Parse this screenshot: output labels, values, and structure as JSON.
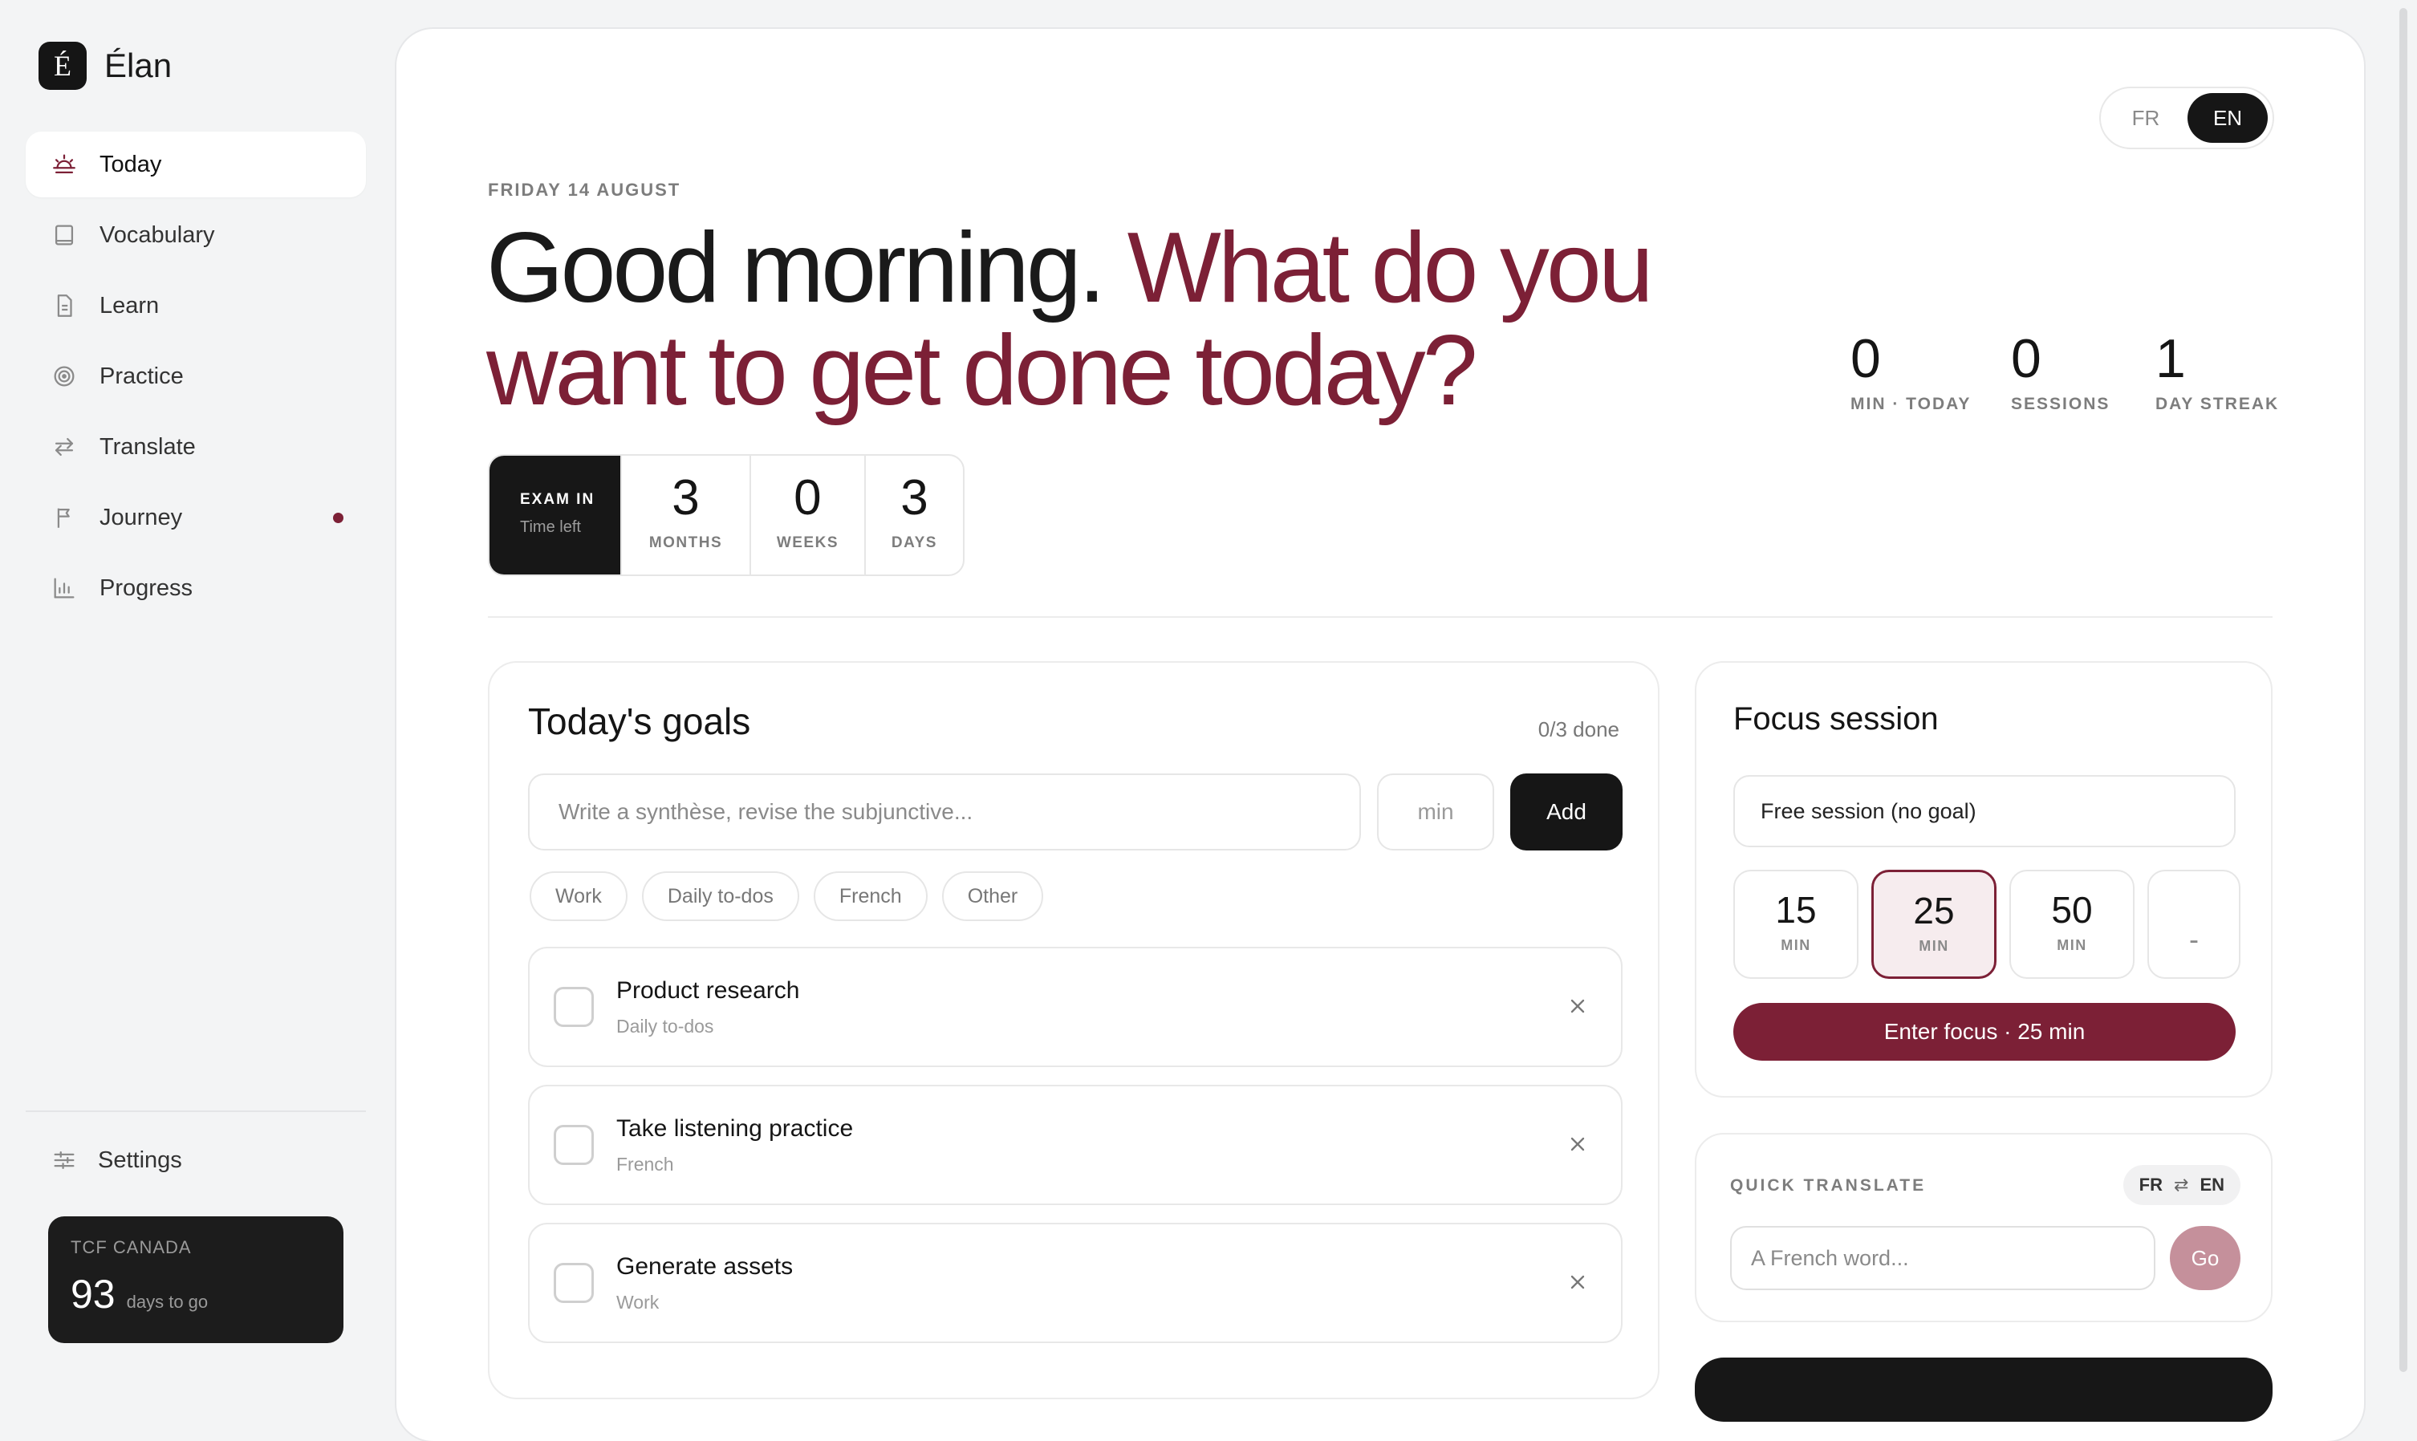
{
  "brand": {
    "mark": "É",
    "name": "Élan"
  },
  "nav": {
    "items": [
      {
        "label": "Today",
        "icon": "sunrise-icon",
        "active": true
      },
      {
        "label": "Vocabulary",
        "icon": "book-icon"
      },
      {
        "label": "Learn",
        "icon": "document-icon"
      },
      {
        "label": "Practice",
        "icon": "target-icon"
      },
      {
        "label": "Translate",
        "icon": "swap-arrows-icon"
      },
      {
        "label": "Journey",
        "icon": "flag-icon",
        "badge": true
      },
      {
        "label": "Progress",
        "icon": "bar-chart-icon"
      }
    ],
    "settings_label": "Settings"
  },
  "exam_card": {
    "label": "TCF CANADA",
    "days": "93",
    "suffix": "days to go"
  },
  "lang_toggle": {
    "options": [
      "FR",
      "EN"
    ],
    "selected": "EN"
  },
  "header": {
    "date": "FRIDAY 14 AUGUST",
    "greeting": "Good morning.",
    "question": "What do you want to get done today?"
  },
  "stats": [
    {
      "value": "0",
      "label": "MIN · TODAY"
    },
    {
      "value": "0",
      "label": "SESSIONS"
    },
    {
      "value": "1",
      "label": "DAY STREAK"
    }
  ],
  "countdown": {
    "title": "EXAM IN",
    "subtitle": "Time left",
    "units": [
      {
        "value": "3",
        "label": "MONTHS"
      },
      {
        "value": "0",
        "label": "WEEKS"
      },
      {
        "value": "3",
        "label": "DAYS"
      }
    ]
  },
  "goals": {
    "title": "Today's goals",
    "count": "0/3 done",
    "input_placeholder": "Write a synthèse, revise the subjunctive...",
    "minutes_placeholder": "min",
    "add_label": "Add",
    "categories": [
      "Work",
      "Daily to-dos",
      "French",
      "Other"
    ],
    "tasks": [
      {
        "title": "Product research",
        "category": "Daily to-dos",
        "done": false
      },
      {
        "title": "Take listening practice",
        "category": "French",
        "done": false
      },
      {
        "title": "Generate assets",
        "category": "Work",
        "done": false
      }
    ]
  },
  "focus": {
    "title": "Focus session",
    "goal_select": "Free session (no goal)",
    "durations": [
      {
        "value": "15",
        "unit": "MIN"
      },
      {
        "value": "25",
        "unit": "MIN",
        "selected": true
      },
      {
        "value": "50",
        "unit": "MIN"
      }
    ],
    "custom": "-",
    "button": "Enter focus · 25 min"
  },
  "quick_translate": {
    "label": "QUICK TRANSLATE",
    "from": "FR",
    "to": "EN",
    "placeholder": "A French word...",
    "go_label": "Go"
  },
  "colors": {
    "accent": "#7c2036",
    "dark": "#161616",
    "background": "#f3f4f5"
  }
}
